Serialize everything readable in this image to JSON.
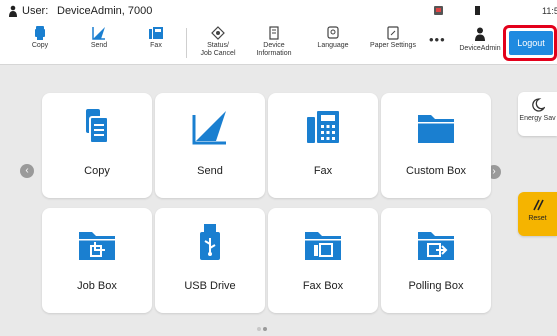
{
  "status": {
    "user_label": "User:",
    "user_value": "DeviceAdmin, 7000",
    "clock": "11:5"
  },
  "toolbar": {
    "copy": "Copy",
    "send": "Send",
    "fax": "Fax",
    "status_line1": "Status/",
    "status_line2": "Job Cancel",
    "devinfo_line1": "Device",
    "devinfo_line2": "Information",
    "language": "Language",
    "paper_settings": "Paper Settings",
    "more": "•••",
    "admin": "DeviceAdmin",
    "logout": "Logout"
  },
  "tiles": [
    {
      "label": "Copy"
    },
    {
      "label": "Send"
    },
    {
      "label": "Fax"
    },
    {
      "label": "Custom Box"
    },
    {
      "label": "Job Box"
    },
    {
      "label": "USB Drive"
    },
    {
      "label": "Fax Box"
    },
    {
      "label": "Polling Box"
    }
  ],
  "side": {
    "energy": "Energy Sav",
    "reset": "Reset"
  },
  "colors": {
    "accent": "#1f8ae0",
    "highlight": "#e3001b",
    "reset": "#f5b400"
  }
}
